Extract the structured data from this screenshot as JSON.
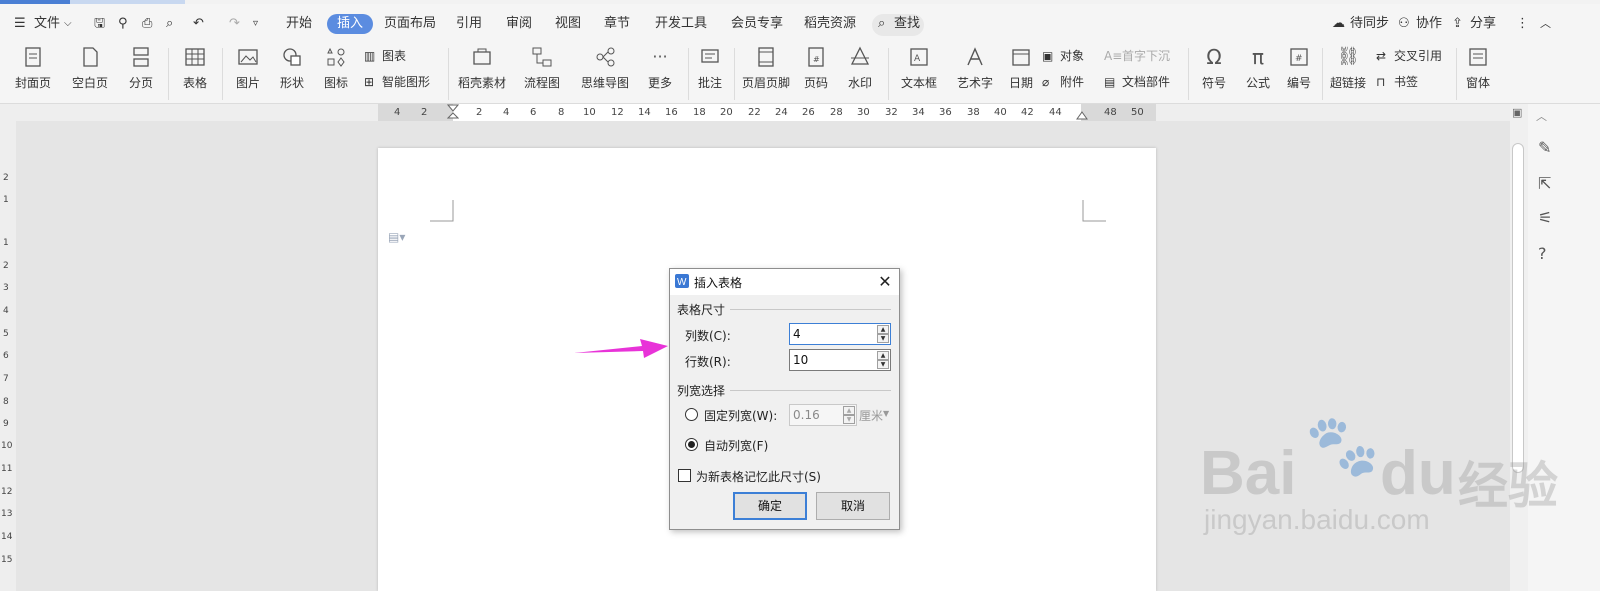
{
  "menubar": {
    "file": "文件",
    "tabs": [
      "开始",
      "插入",
      "页面布局",
      "引用",
      "审阅",
      "视图",
      "章节",
      "开发工具",
      "会员专享",
      "稻壳资源"
    ],
    "active_tab": "插入",
    "search": "查找",
    "sync": "待同步",
    "collab": "协作",
    "share": "分享"
  },
  "ribbon": {
    "cover": "封面页",
    "blank": "空白页",
    "pagebreak": "分页",
    "table": "表格",
    "picture": "图片",
    "shape": "形状",
    "icons": "图标",
    "chart": "图表",
    "smartart": "智能图形",
    "docer": "稻壳素材",
    "flowchart": "流程图",
    "mindmap": "思维导图",
    "more": "更多",
    "comment": "批注",
    "header_footer": "页眉页脚",
    "pagenum": "页码",
    "watermark": "水印",
    "textbox": "文本框",
    "wordart": "艺术字",
    "date": "日期",
    "object": "对象",
    "attachment": "附件",
    "dropcap": "首字下沉",
    "docparts": "文档部件",
    "symbol": "符号",
    "formula": "公式",
    "numbering": "编号",
    "hyperlink": "超链接",
    "crossref": "交叉引用",
    "bookmark": "书签",
    "window": "窗体"
  },
  "ruler_h": [
    "4",
    "2",
    "2",
    "4",
    "6",
    "8",
    "10",
    "12",
    "14",
    "16",
    "18",
    "20",
    "22",
    "24",
    "26",
    "28",
    "30",
    "32",
    "34",
    "36",
    "38",
    "40",
    "42",
    "44",
    "48",
    "50"
  ],
  "ruler_v": [
    "2",
    "1",
    "1",
    "2",
    "3",
    "4",
    "5",
    "6",
    "7",
    "8",
    "9",
    "10",
    "11",
    "12",
    "13",
    "14",
    "15"
  ],
  "dialog": {
    "title": "插入表格",
    "size_group": "表格尺寸",
    "cols_label": "列数(C):",
    "cols_value": "4",
    "rows_label": "行数(R):",
    "rows_value": "10",
    "width_group": "列宽选择",
    "fixed_label": "固定列宽(W):",
    "fixed_value": "0.16",
    "fixed_unit": "厘米",
    "auto_label": "自动列宽(F)",
    "remember_label": "为新表格记忆此尺寸(S)",
    "ok": "确定",
    "cancel": "取消"
  },
  "watermark": {
    "brand": "Bai",
    "brand2": "du",
    "cn": "经验",
    "url": "jingyan.baidu.com"
  },
  "colors": {
    "accent": "#5b8ce0",
    "arrow": "#e833d8"
  }
}
